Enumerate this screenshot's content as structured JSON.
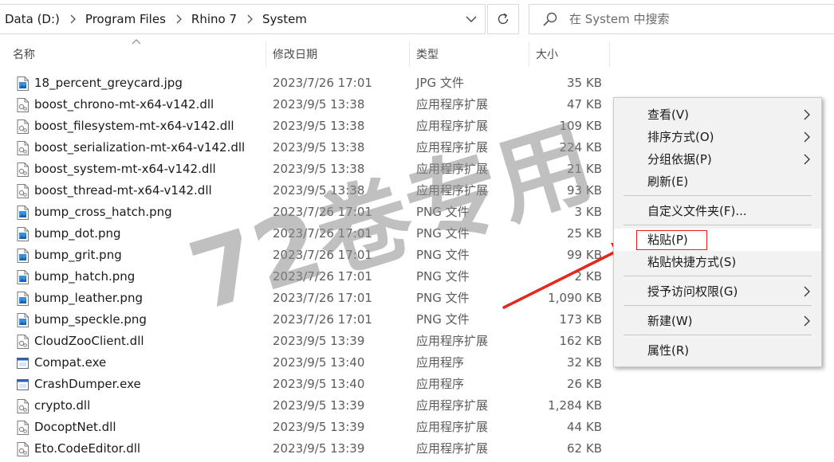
{
  "address": {
    "crumbs": [
      "Data (D:)",
      "Program Files",
      "Rhino 7",
      "System"
    ]
  },
  "search": {
    "placeholder": "在 System 中搜索"
  },
  "columns": {
    "name": "名称",
    "date": "修改日期",
    "type": "类型",
    "size": "大小"
  },
  "files": [
    {
      "name": "18_percent_greycard.jpg",
      "date": "2023/7/26 17:01",
      "type": "JPG 文件",
      "size": "35 KB",
      "icon": "image-file-icon"
    },
    {
      "name": "boost_chrono-mt-x64-v142.dll",
      "date": "2023/9/5 13:38",
      "type": "应用程序扩展",
      "size": "47 KB",
      "icon": "dll-file-icon"
    },
    {
      "name": "boost_filesystem-mt-x64-v142.dll",
      "date": "2023/9/5 13:38",
      "type": "应用程序扩展",
      "size": "109 KB",
      "icon": "dll-file-icon"
    },
    {
      "name": "boost_serialization-mt-x64-v142.dll",
      "date": "2023/9/5 13:38",
      "type": "应用程序扩展",
      "size": "224 KB",
      "icon": "dll-file-icon"
    },
    {
      "name": "boost_system-mt-x64-v142.dll",
      "date": "2023/9/5 13:38",
      "type": "应用程序扩展",
      "size": "21 KB",
      "icon": "dll-file-icon"
    },
    {
      "name": "boost_thread-mt-x64-v142.dll",
      "date": "2023/9/5 13:38",
      "type": "应用程序扩展",
      "size": "93 KB",
      "icon": "dll-file-icon"
    },
    {
      "name": "bump_cross_hatch.png",
      "date": "2023/7/26 17:01",
      "type": "PNG 文件",
      "size": "3 KB",
      "icon": "image-file-icon"
    },
    {
      "name": "bump_dot.png",
      "date": "2023/7/26 17:01",
      "type": "PNG 文件",
      "size": "25 KB",
      "icon": "image-file-icon"
    },
    {
      "name": "bump_grit.png",
      "date": "2023/7/26 17:01",
      "type": "PNG 文件",
      "size": "99 KB",
      "icon": "image-file-icon"
    },
    {
      "name": "bump_hatch.png",
      "date": "2023/7/26 17:01",
      "type": "PNG 文件",
      "size": "2 KB",
      "icon": "image-file-icon"
    },
    {
      "name": "bump_leather.png",
      "date": "2023/7/26 17:01",
      "type": "PNG 文件",
      "size": "1,090 KB",
      "icon": "image-file-icon"
    },
    {
      "name": "bump_speckle.png",
      "date": "2023/7/26 17:01",
      "type": "PNG 文件",
      "size": "173 KB",
      "icon": "image-file-icon"
    },
    {
      "name": "CloudZooClient.dll",
      "date": "2023/9/5 13:39",
      "type": "应用程序扩展",
      "size": "162 KB",
      "icon": "dll-file-icon"
    },
    {
      "name": "Compat.exe",
      "date": "2023/9/5 13:40",
      "type": "应用程序",
      "size": "32 KB",
      "icon": "exe-file-icon"
    },
    {
      "name": "CrashDumper.exe",
      "date": "2023/9/5 13:40",
      "type": "应用程序",
      "size": "26 KB",
      "icon": "exe-file-icon"
    },
    {
      "name": "crypto.dll",
      "date": "2023/9/5 13:39",
      "type": "应用程序扩展",
      "size": "1,284 KB",
      "icon": "dll-file-icon"
    },
    {
      "name": "DocoptNet.dll",
      "date": "2023/9/5 13:39",
      "type": "应用程序扩展",
      "size": "44 KB",
      "icon": "dll-file-icon"
    },
    {
      "name": "Eto.CodeEditor.dll",
      "date": "2023/9/5 13:39",
      "type": "应用程序扩展",
      "size": "62 KB",
      "icon": "dll-file-icon"
    }
  ],
  "context_menu": {
    "view": "查看(V)",
    "sort": "排序方式(O)",
    "group": "分组依据(P)",
    "refresh": "刷新(E)",
    "customize": "自定义文件夹(F)...",
    "paste": "粘贴(P)",
    "paste_shortcut": "粘贴快捷方式(S)",
    "give_access": "授予访问权限(G)",
    "new": "新建(W)",
    "properties": "属性(R)"
  },
  "watermark": "72卷专用",
  "colors": {
    "highlight_border": "#e02020",
    "arrow": "#e8261d"
  }
}
